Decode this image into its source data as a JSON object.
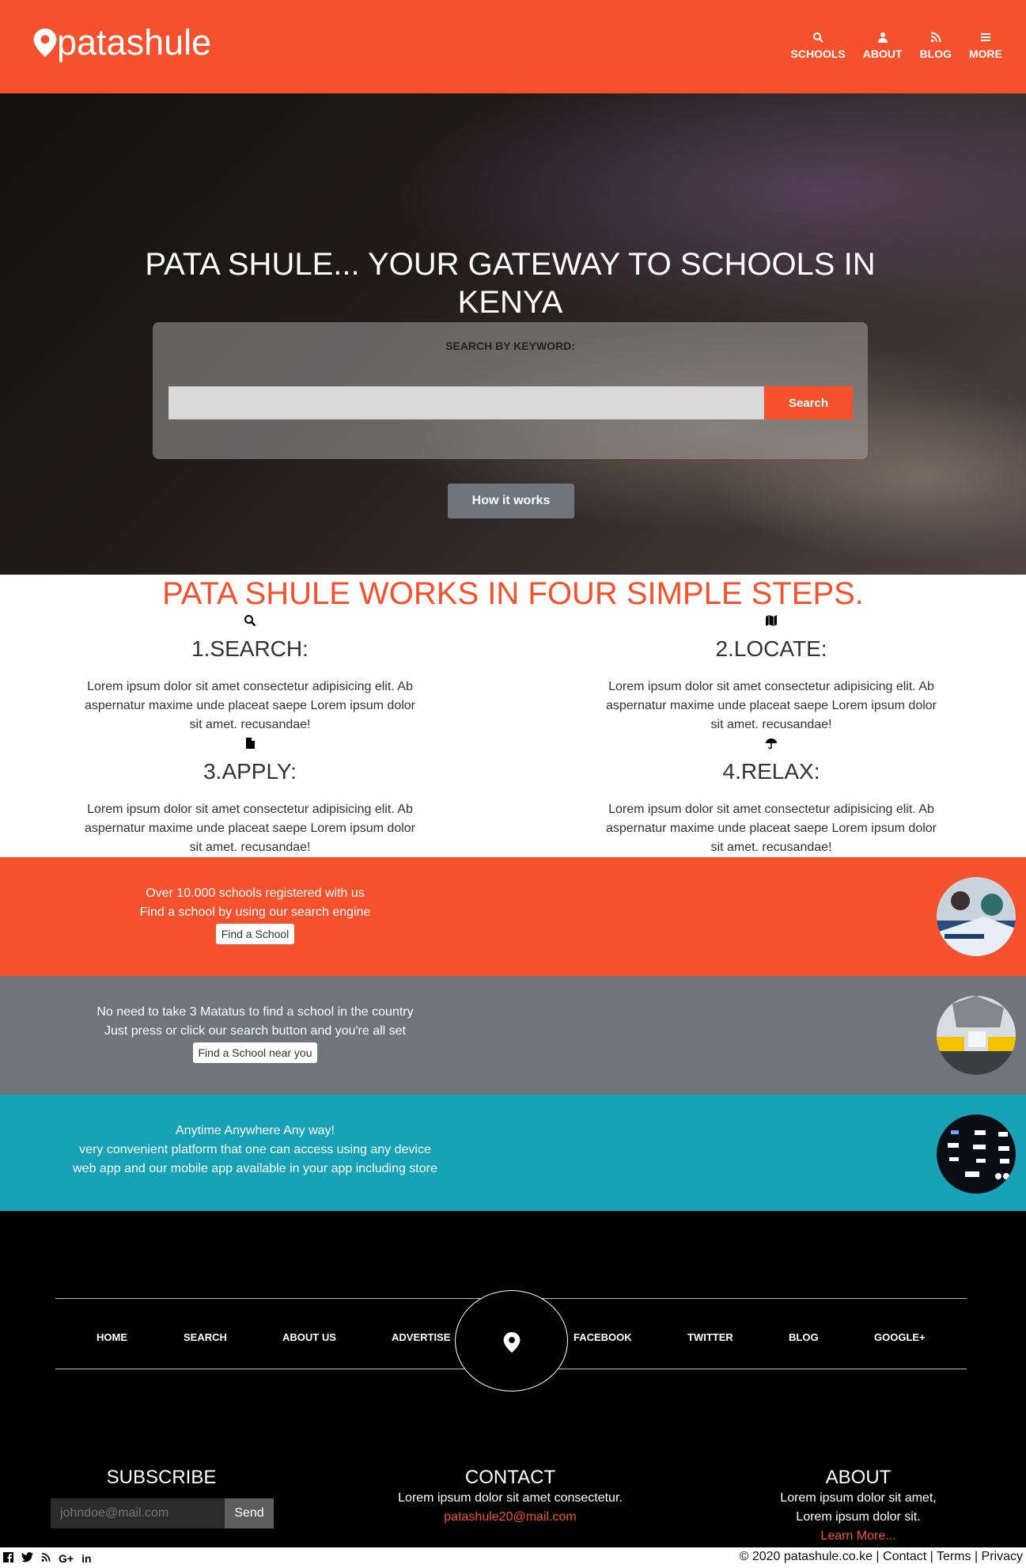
{
  "header": {
    "logo_text": "patashule",
    "nav": [
      {
        "label": "SCHOOLS",
        "icon": "search-icon"
      },
      {
        "label": "ABOUT",
        "icon": "user-icon"
      },
      {
        "label": "BLOG",
        "icon": "rss-icon"
      },
      {
        "label": "MORE",
        "icon": "menu-icon"
      }
    ]
  },
  "hero": {
    "title": "PATA SHULE... YOUR GATEWAY TO SCHOOLS IN KENYA",
    "search_label": "SEARCH BY KEYWORD:",
    "search_placeholder": "",
    "search_button": "Search",
    "how_button": "How it works"
  },
  "steps": {
    "title": "PATA SHULE WORKS IN FOUR SIMPLE STEPS.",
    "items": [
      {
        "title": "1.SEARCH:",
        "icon": "search-icon",
        "text": "Lorem ipsum dolor sit amet consectetur adipisicing elit. Ab aspernatur maxime unde placeat saepe Lorem ipsum dolor sit amet. recusandae!"
      },
      {
        "title": "2.LOCATE:",
        "icon": "map-icon",
        "text": "Lorem ipsum dolor sit amet consectetur adipisicing elit. Ab aspernatur maxime unde placeat saepe Lorem ipsum dolor sit amet. recusandae!"
      },
      {
        "title": "3.APPLY:",
        "icon": "file-icon",
        "text": "Lorem ipsum dolor sit amet consectetur adipisicing elit. Ab aspernatur maxime unde placeat saepe Lorem ipsum dolor sit amet. recusandae!"
      },
      {
        "title": "4.RELAX:",
        "icon": "umbrella-icon",
        "text": "Lorem ipsum dolor sit amet consectetur adipisicing elit. Ab aspernatur maxime unde placeat saepe Lorem ipsum dolor sit amet. recusandae!"
      }
    ]
  },
  "bands": [
    {
      "line1": "Over 10.000 schools registered with us",
      "line2": "Find a school by using our search engine",
      "line3": "",
      "button": "Find a School",
      "color": "#f4512c"
    },
    {
      "line1": "No need to take 3 Matatus to find a school in the country",
      "line2": "Just press or click our search button and you're all set",
      "line3": "",
      "button": "Find a School near you",
      "color": "#6f757d"
    },
    {
      "line1": "Anytime Anywhere Any way!",
      "line2": "very convenient platform that one can access using any device",
      "line3": "web app and our mobile app available in your app including store",
      "button": "",
      "color": "#17a2b8"
    }
  ],
  "footer": {
    "nav_left": [
      "HOME",
      "SEARCH",
      "ABOUT US",
      "ADVERTISE"
    ],
    "nav_right": [
      "FACEBOOK",
      "TWITTER",
      "BLOG",
      "GOOGLE+"
    ],
    "subscribe": {
      "title": "SUBSCRIBE",
      "placeholder": "johndoe@mail.com",
      "button": "Send"
    },
    "contact": {
      "title": "CONTACT",
      "text": "Lorem ipsum dolor sit amet consectetur.",
      "email": "patashule20@mail.com"
    },
    "about": {
      "title": "ABOUT",
      "line1": "Lorem ipsum dolor sit amet,",
      "line2": "Lorem ipsum dolor sit.",
      "link": "Learn More..."
    }
  },
  "bottom": {
    "social_icons": [
      "facebook-icon",
      "twitter-icon",
      "rss-icon",
      "google-plus-icon",
      "linkedin-icon"
    ],
    "copyright": "© 2020 patashule.co.ke",
    "links": [
      "Contact",
      "Terms",
      "Privacy"
    ]
  },
  "colors": {
    "brand": "#f4512c",
    "gray": "#6f757d",
    "teal": "#17a2b8",
    "footer": "#000000"
  }
}
